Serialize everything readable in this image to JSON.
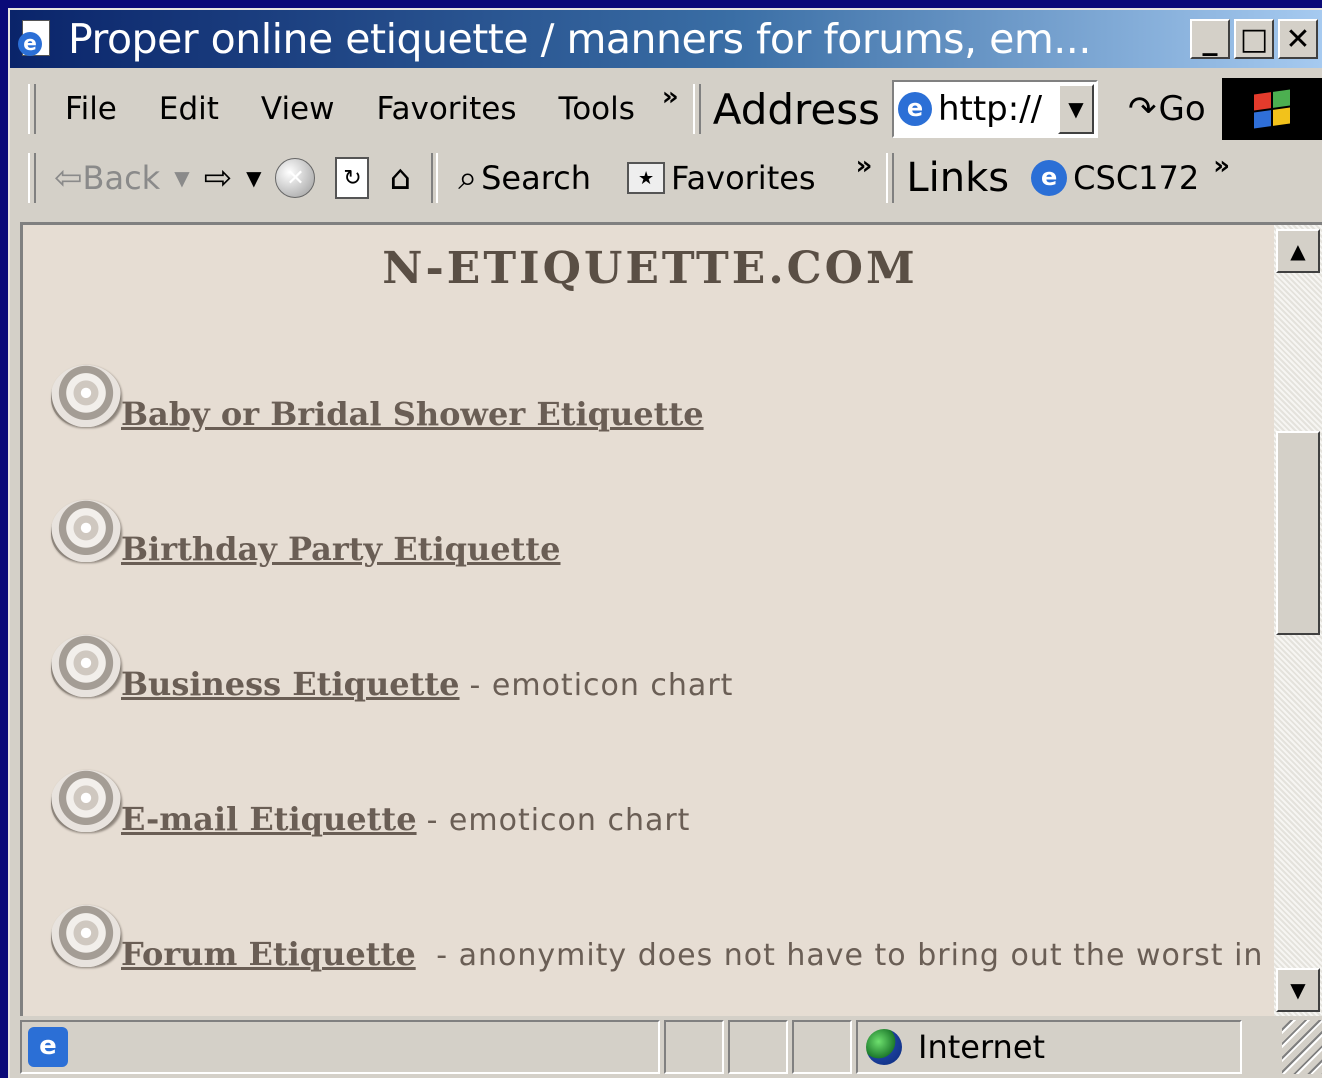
{
  "window": {
    "title": "Proper online etiquette / manners for forums, em...",
    "minimize_label": "_",
    "maximize_label": "□",
    "close_label": "✕"
  },
  "menu": {
    "items": [
      "File",
      "Edit",
      "View",
      "Favorites",
      "Tools"
    ],
    "overflow": "»"
  },
  "address_bar": {
    "label": "Address",
    "value": "http://",
    "go_label": "Go"
  },
  "toolbar": {
    "back_label": "Back",
    "search_label": "Search",
    "favorites_label": "Favorites",
    "overflow": "»",
    "links_label": "Links",
    "link_items": [
      "CSC172"
    ],
    "links_overflow": "»"
  },
  "page": {
    "site_title": "N-ETIQUETTE.COM",
    "items": [
      {
        "link": "Baby  or Bridal Shower  Etiquette",
        "desc": ""
      },
      {
        "link": "Birthday Party Etiquette",
        "desc": ""
      },
      {
        "link": "Business Etiquette",
        "desc": "- emoticon chart"
      },
      {
        "link": "E-mail Etiquette",
        "desc": "-  emoticon chart"
      },
      {
        "link": "Forum Etiquette",
        "desc": " - anonymity does not have to bring out the worst in us"
      }
    ]
  },
  "status_bar": {
    "zone": "Internet"
  },
  "colors": {
    "title_bar_start": "#0a246a",
    "title_bar_end": "#a6caf0",
    "page_background": "#e6ddd3",
    "link_text": "#6a5e55",
    "desktop": "#0a0a78"
  }
}
